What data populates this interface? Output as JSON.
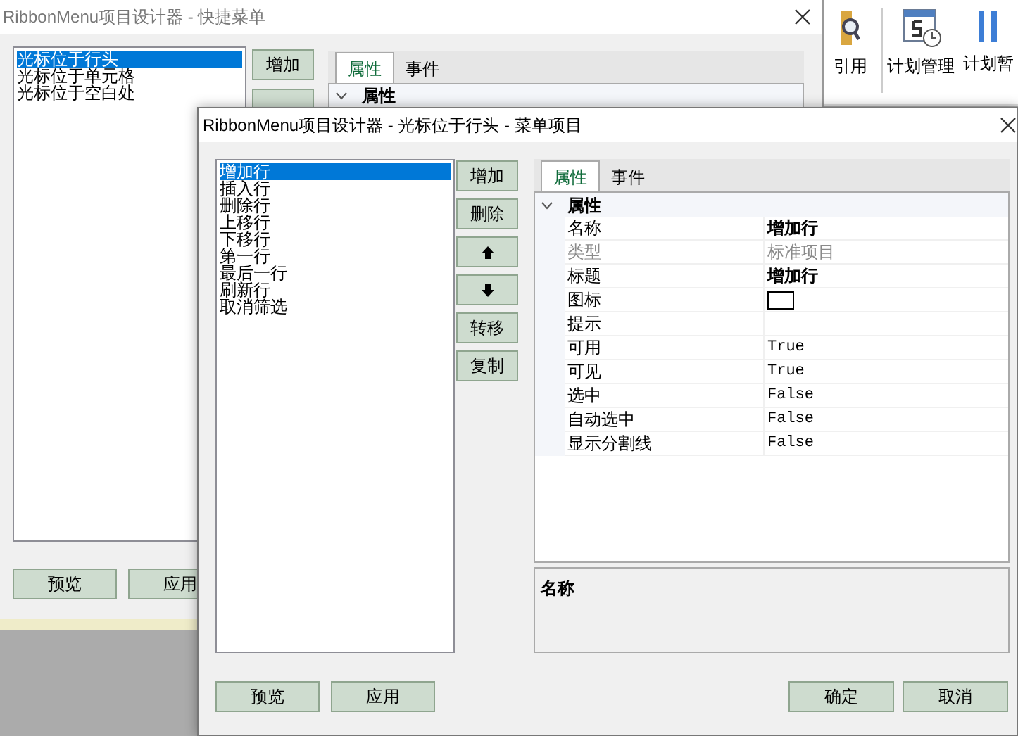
{
  "ribbon": {
    "items": [
      {
        "label": "引用",
        "kind": "reference"
      },
      {
        "label": "计划管理",
        "kind": "calendar"
      },
      {
        "label": "计划暂",
        "kind": "pause"
      }
    ]
  },
  "back_window": {
    "title": "RibbonMenu项目设计器 - 快捷菜单",
    "list": [
      {
        "label": "光标位于行头",
        "selected": true
      },
      {
        "label": "光标位于单元格",
        "selected": false
      },
      {
        "label": "光标位于空白处",
        "selected": false
      }
    ],
    "side_buttons": [
      "增加"
    ],
    "tabs": [
      {
        "label": "属性",
        "selected": true
      },
      {
        "label": "事件",
        "selected": false
      }
    ],
    "grid_category": "属性",
    "footer_buttons": [
      "预览",
      "应用"
    ]
  },
  "front_window": {
    "title": "RibbonMenu项目设计器 - 光标位于行头 - 菜单项目",
    "list": [
      {
        "label": "增加行",
        "selected": true
      },
      {
        "label": "插入行",
        "selected": false
      },
      {
        "label": "删除行",
        "selected": false
      },
      {
        "label": "上移行",
        "selected": false
      },
      {
        "label": "下移行",
        "selected": false
      },
      {
        "label": "第一行",
        "selected": false
      },
      {
        "label": "最后一行",
        "selected": false
      },
      {
        "label": "刷新行",
        "selected": false
      },
      {
        "label": "取消筛选",
        "selected": false
      }
    ],
    "side_buttons": [
      {
        "kind": "text",
        "label": "增加"
      },
      {
        "kind": "text",
        "label": "删除"
      },
      {
        "kind": "up"
      },
      {
        "kind": "down"
      },
      {
        "kind": "text",
        "label": "转移"
      },
      {
        "kind": "text",
        "label": "复制"
      }
    ],
    "tabs": [
      {
        "label": "属性",
        "selected": true
      },
      {
        "label": "事件",
        "selected": false
      }
    ],
    "grid": {
      "category": "属性",
      "expanded": true,
      "rows": [
        {
          "name": "名称",
          "value": "增加行",
          "kind": "bold"
        },
        {
          "name": "类型",
          "value": "标准项目",
          "kind": "disabled"
        },
        {
          "name": "标题",
          "value": "增加行",
          "kind": "bold"
        },
        {
          "name": "图标",
          "kind": "swatch"
        },
        {
          "name": "提示",
          "kind": "empty"
        },
        {
          "name": "可用",
          "value": "True",
          "kind": "mono"
        },
        {
          "name": "可见",
          "value": "True",
          "kind": "mono"
        },
        {
          "name": "选中",
          "value": "False",
          "kind": "mono"
        },
        {
          "name": "自动选中",
          "value": "False",
          "kind": "mono"
        },
        {
          "name": "显示分割线",
          "value": "False",
          "kind": "mono"
        }
      ]
    },
    "description": {
      "title": "名称"
    },
    "footer_left": [
      "预览",
      "应用"
    ],
    "footer_right": [
      "确定",
      "取消"
    ]
  }
}
